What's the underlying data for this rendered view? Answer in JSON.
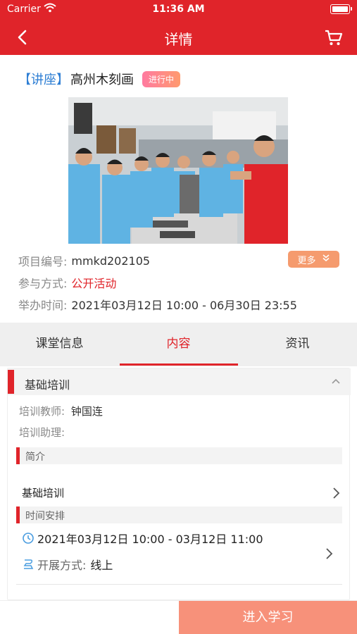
{
  "status_bar": {
    "carrier": "Carrier",
    "time": "11:36 AM"
  },
  "navbar": {
    "title": "详情"
  },
  "event": {
    "category": "【讲座】",
    "name": "高州木刻画",
    "status": "进行中",
    "project_no_label": "项目编号:",
    "project_no": "mmkd202105",
    "join_label": "参与方式:",
    "join_value": "公开活动",
    "time_label": "举办时间:",
    "time_value": "2021年03月12日 10:00 - 06月30日 23:55",
    "more_label": "更多"
  },
  "tabs": [
    {
      "label": "课堂信息"
    },
    {
      "label": "内容"
    },
    {
      "label": "资讯"
    }
  ],
  "active_tab": 1,
  "content": {
    "section_title": "基础培训",
    "teacher_label": "培训教师:",
    "teacher": "钟国连",
    "assistant_label": "培训助理:",
    "intro_title": "简介",
    "intro_text": "基础培训",
    "schedule_title": "时间安排",
    "schedule_time": "2021年03月12日 10:00 - 03月12日 11:00",
    "mode_label": "开展方式:",
    "mode_value": "线上"
  },
  "bottom": {
    "enter_label": "进入学习"
  },
  "colors": {
    "primary": "#e0242a",
    "link": "#2f7fd4",
    "cta": "#f7917a",
    "more": "#f59b6e"
  },
  "icons": [
    "back-icon",
    "cart-icon",
    "wifi-icon",
    "battery-icon",
    "chevron-up-icon",
    "chevron-right-icon",
    "clock-icon",
    "mode-icon",
    "double-chevron-down-icon"
  ]
}
